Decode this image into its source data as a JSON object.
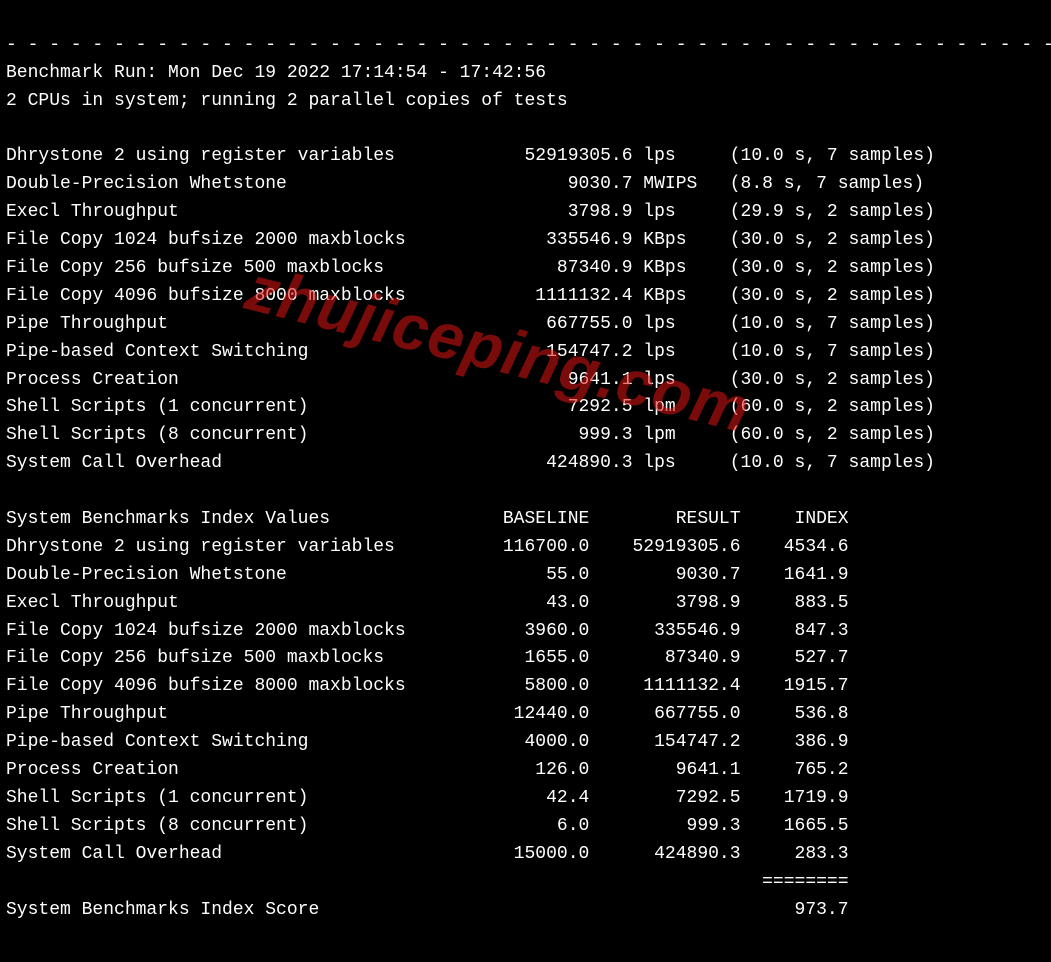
{
  "separator": "-",
  "header": {
    "run_line": "Benchmark Run: Mon Dec 19 2022 17:14:54 - 17:42:56",
    "cpu_line": "2 CPUs in system; running 2 parallel copies of tests"
  },
  "tests": [
    {
      "name": "Dhrystone 2 using register variables",
      "value": "52919305.6",
      "unit": "lps",
      "timing": "(10.0 s, 7 samples)"
    },
    {
      "name": "Double-Precision Whetstone",
      "value": "9030.7",
      "unit": "MWIPS",
      "timing": "(8.8 s, 7 samples)"
    },
    {
      "name": "Execl Throughput",
      "value": "3798.9",
      "unit": "lps",
      "timing": "(29.9 s, 2 samples)"
    },
    {
      "name": "File Copy 1024 bufsize 2000 maxblocks",
      "value": "335546.9",
      "unit": "KBps",
      "timing": "(30.0 s, 2 samples)"
    },
    {
      "name": "File Copy 256 bufsize 500 maxblocks",
      "value": "87340.9",
      "unit": "KBps",
      "timing": "(30.0 s, 2 samples)"
    },
    {
      "name": "File Copy 4096 bufsize 8000 maxblocks",
      "value": "1111132.4",
      "unit": "KBps",
      "timing": "(30.0 s, 2 samples)"
    },
    {
      "name": "Pipe Throughput",
      "value": "667755.0",
      "unit": "lps",
      "timing": "(10.0 s, 7 samples)"
    },
    {
      "name": "Pipe-based Context Switching",
      "value": "154747.2",
      "unit": "lps",
      "timing": "(10.0 s, 7 samples)"
    },
    {
      "name": "Process Creation",
      "value": "9641.1",
      "unit": "lps",
      "timing": "(30.0 s, 2 samples)"
    },
    {
      "name": "Shell Scripts (1 concurrent)",
      "value": "7292.5",
      "unit": "lpm",
      "timing": "(60.0 s, 2 samples)"
    },
    {
      "name": "Shell Scripts (8 concurrent)",
      "value": "999.3",
      "unit": "lpm",
      "timing": "(60.0 s, 2 samples)"
    },
    {
      "name": "System Call Overhead",
      "value": "424890.3",
      "unit": "lps",
      "timing": "(10.0 s, 7 samples)"
    }
  ],
  "index_header": {
    "title": "System Benchmarks Index Values",
    "col_baseline": "BASELINE",
    "col_result": "RESULT",
    "col_index": "INDEX"
  },
  "index_rows": [
    {
      "name": "Dhrystone 2 using register variables",
      "baseline": "116700.0",
      "result": "52919305.6",
      "index": "4534.6"
    },
    {
      "name": "Double-Precision Whetstone",
      "baseline": "55.0",
      "result": "9030.7",
      "index": "1641.9"
    },
    {
      "name": "Execl Throughput",
      "baseline": "43.0",
      "result": "3798.9",
      "index": "883.5"
    },
    {
      "name": "File Copy 1024 bufsize 2000 maxblocks",
      "baseline": "3960.0",
      "result": "335546.9",
      "index": "847.3"
    },
    {
      "name": "File Copy 256 bufsize 500 maxblocks",
      "baseline": "1655.0",
      "result": "87340.9",
      "index": "527.7"
    },
    {
      "name": "File Copy 4096 bufsize 8000 maxblocks",
      "baseline": "5800.0",
      "result": "1111132.4",
      "index": "1915.7"
    },
    {
      "name": "Pipe Throughput",
      "baseline": "12440.0",
      "result": "667755.0",
      "index": "536.8"
    },
    {
      "name": "Pipe-based Context Switching",
      "baseline": "4000.0",
      "result": "154747.2",
      "index": "386.9"
    },
    {
      "name": "Process Creation",
      "baseline": "126.0",
      "result": "9641.1",
      "index": "765.2"
    },
    {
      "name": "Shell Scripts (1 concurrent)",
      "baseline": "42.4",
      "result": "7292.5",
      "index": "1719.9"
    },
    {
      "name": "Shell Scripts (8 concurrent)",
      "baseline": "6.0",
      "result": "999.3",
      "index": "1665.5"
    },
    {
      "name": "System Call Overhead",
      "baseline": "15000.0",
      "result": "424890.3",
      "index": "283.3"
    }
  ],
  "score_divider": "========",
  "score": {
    "label": "System Benchmarks Index Score",
    "value": "973.7"
  },
  "watermark": "zhujiceping.com"
}
